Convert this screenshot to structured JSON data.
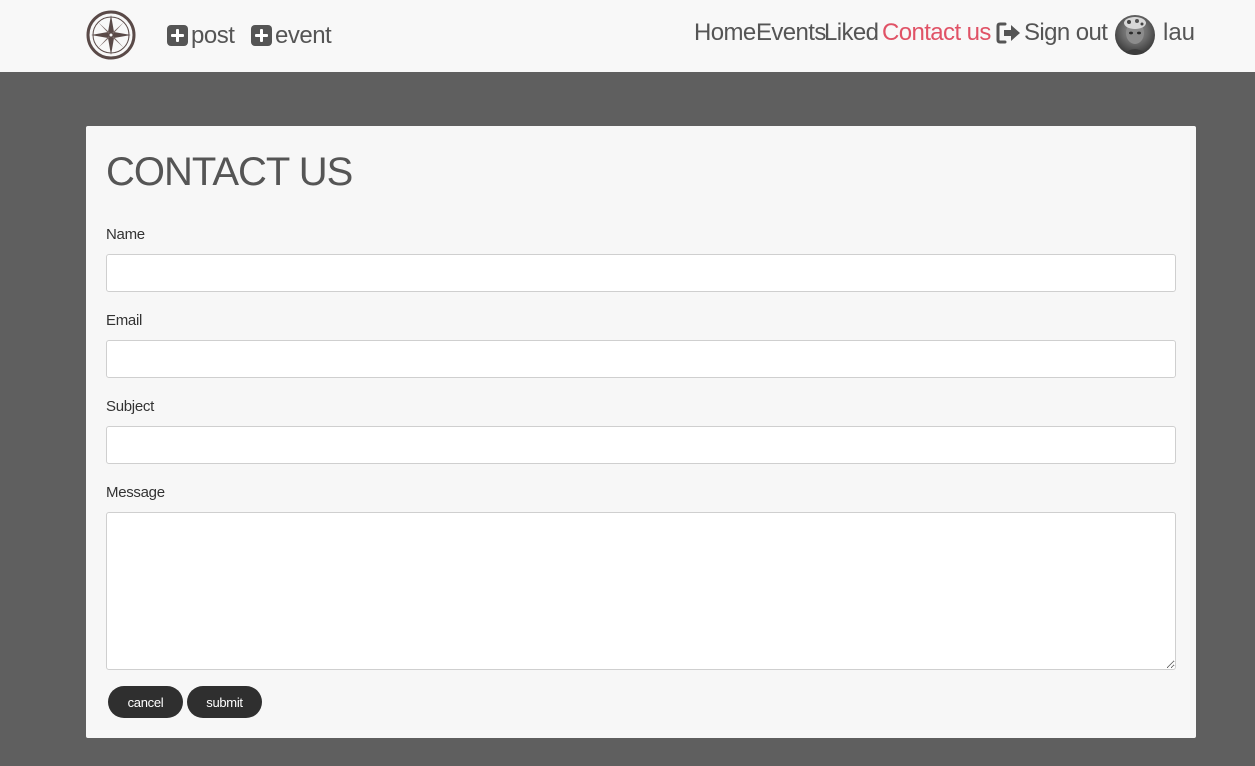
{
  "navbar": {
    "create_post_label": "post",
    "create_event_label": "event",
    "links": {
      "home": "Home",
      "events": "Events",
      "liked": "Liked",
      "contact": "Contact us"
    },
    "sign_out_label": "Sign out",
    "username": "lau"
  },
  "form": {
    "title": "CONTACT US",
    "name_label": "Name",
    "email_label": "Email",
    "subject_label": "Subject",
    "message_label": "Message",
    "name_value": "",
    "email_value": "",
    "subject_value": "",
    "message_value": "",
    "cancel_label": "cancel",
    "submit_label": "submit"
  },
  "icons": {
    "logo": "compass-logo-icon",
    "create": "plus-square-icon",
    "sign_out": "sign-out-icon"
  },
  "colors": {
    "page_background": "#5f5f5f",
    "navbar_background": "#f8f8f8",
    "card_background": "#f7f7f7",
    "active_link": "#e05266",
    "text": "#555555",
    "button": "#2f2f2f"
  }
}
